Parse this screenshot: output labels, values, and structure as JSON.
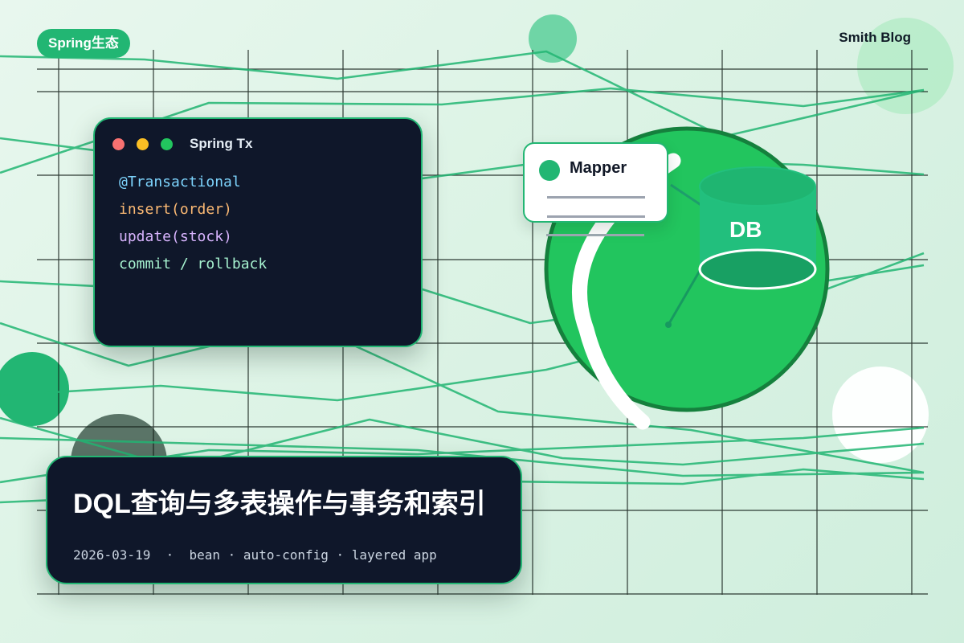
{
  "tag": "Spring生态",
  "brand": "Smith Blog",
  "code_window": {
    "title": "Spring Tx",
    "lines": [
      {
        "text": "@Transactional",
        "color": "#7dd3fc"
      },
      {
        "text": "insert(order)",
        "color": "#fdba74"
      },
      {
        "text": "update(stock)",
        "color": "#d8b4fe"
      },
      {
        "text": "commit / rollback",
        "color": "#a7f3d0"
      }
    ]
  },
  "diagram": {
    "mapper_label": "Mapper",
    "db_label": "DB"
  },
  "post": {
    "title": "DQL查询与多表操作与事务和索引",
    "meta": "2026-03-19  ·  bean · auto-config · layered app"
  },
  "colors": {
    "accent": "#22b673",
    "sphere": "#22c55e",
    "dark_card": "#0f172a"
  }
}
